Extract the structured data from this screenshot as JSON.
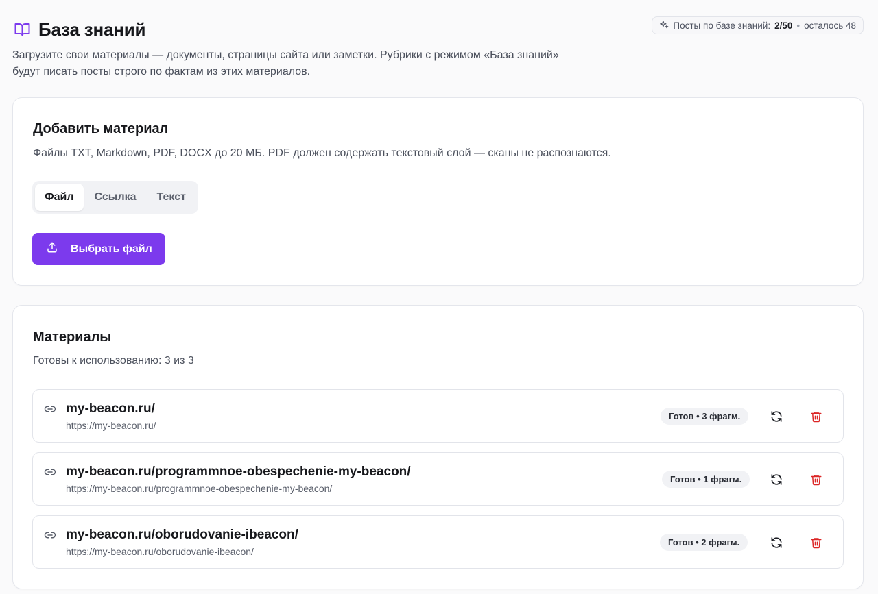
{
  "header": {
    "title": "База знаний",
    "description": "Загрузите свои материалы — документы, страницы сайта или заметки. Рубрики с режимом «База знаний» будут писать посты строго по фактам из этих материалов.",
    "quota": {
      "label": "Посты по базе знаний:",
      "value": "2/50",
      "separator": "•",
      "remaining": "осталось 48"
    }
  },
  "add_material": {
    "title": "Добавить материал",
    "subtitle": "Файлы TXT, Markdown, PDF, DOCX до 20 МБ. PDF должен содержать текстовый слой — сканы не распознаются.",
    "tabs": [
      {
        "label": "Файл",
        "active": true
      },
      {
        "label": "Ссылка",
        "active": false
      },
      {
        "label": "Текст",
        "active": false
      }
    ],
    "upload_button": "Выбрать файл"
  },
  "materials": {
    "title": "Материалы",
    "summary": "Готовы к использованию: 3 из 3",
    "items": [
      {
        "title": "my-beacon.ru/",
        "url": "https://my-beacon.ru/",
        "status": "Готов • 3 фрагм."
      },
      {
        "title": "my-beacon.ru/programmnoe-obespechenie-my-beacon/",
        "url": "https://my-beacon.ru/programmnoe-obespechenie-my-beacon/",
        "status": "Готов • 1 фрагм."
      },
      {
        "title": "my-beacon.ru/oborudovanie-ibeacon/",
        "url": "https://my-beacon.ru/oborudovanie-ibeacon/",
        "status": "Готов • 2 фрагм."
      }
    ]
  },
  "colors": {
    "accent": "#7c3aed",
    "danger": "#dc2626",
    "badge_bg": "#f1f2f5",
    "border": "#e2e4ea"
  },
  "icons": {
    "title": "book-open-icon",
    "quota": "sparkles-icon",
    "upload": "upload-icon",
    "item_type": "link-icon",
    "refresh": "refresh-icon",
    "delete": "trash-icon"
  }
}
